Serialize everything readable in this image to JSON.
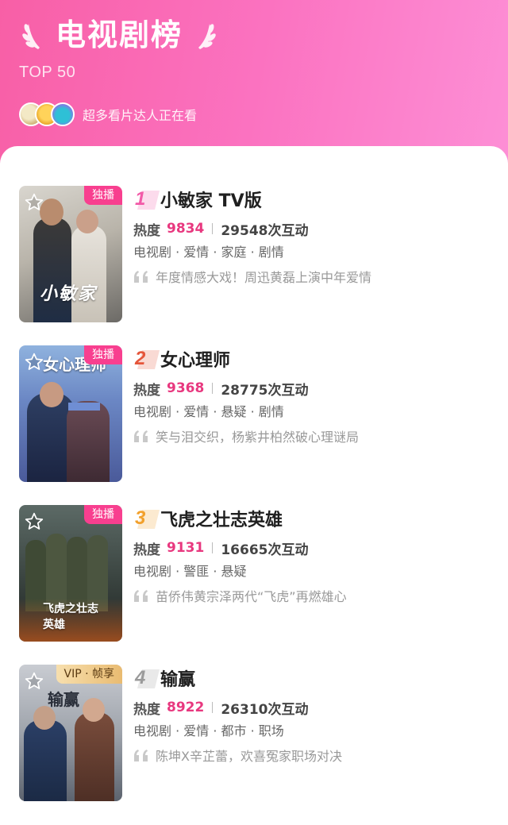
{
  "header": {
    "title": "电视剧榜",
    "subtitle": "TOP 50",
    "watchers_text": "超多看片达人正在看"
  },
  "colors": {
    "accent_pink": "#e8387f",
    "badge_pink": "#f83f8f",
    "rank1": "#f25aa8",
    "rank2": "#e5553a",
    "rank3": "#f2a02b",
    "rank4": "#9a9a9a"
  },
  "items": [
    {
      "rank": "1",
      "name": "小敏家 TV版",
      "badge": "独播",
      "heat_label": "热度",
      "heat": "9834",
      "interactions": "29548次互动",
      "tags": "电视剧 · 爱情 · 家庭 · 剧情",
      "quote": "年度情感大戏！周迅黄磊上演中年爱情",
      "poster_text": "小敏家"
    },
    {
      "rank": "2",
      "name": "女心理师",
      "badge": "独播",
      "heat_label": "热度",
      "heat": "9368",
      "interactions": "28775次互动",
      "tags": "电视剧 · 爱情 · 悬疑 · 剧情",
      "quote": "笑与泪交织，杨紫井柏然破心理谜局",
      "poster_text": "女心理师"
    },
    {
      "rank": "3",
      "name": "飞虎之壮志英雄",
      "badge": "独播",
      "heat_label": "热度",
      "heat": "9131",
      "interactions": "16665次互动",
      "tags": "电视剧 · 警匪 · 悬疑",
      "quote": "苗侨伟黄宗泽两代“飞虎”再燃雄心",
      "poster_text": "飞虎之壮志英雄"
    },
    {
      "rank": "4",
      "name": "输赢",
      "badge": "VIP · 帧享",
      "heat_label": "热度",
      "heat": "8922",
      "interactions": "26310次互动",
      "tags": "电视剧 · 爱情 · 都市 · 职场",
      "quote": "陈坤X辛芷蕾，欢喜冤家职场对决",
      "poster_text": "输赢"
    }
  ]
}
